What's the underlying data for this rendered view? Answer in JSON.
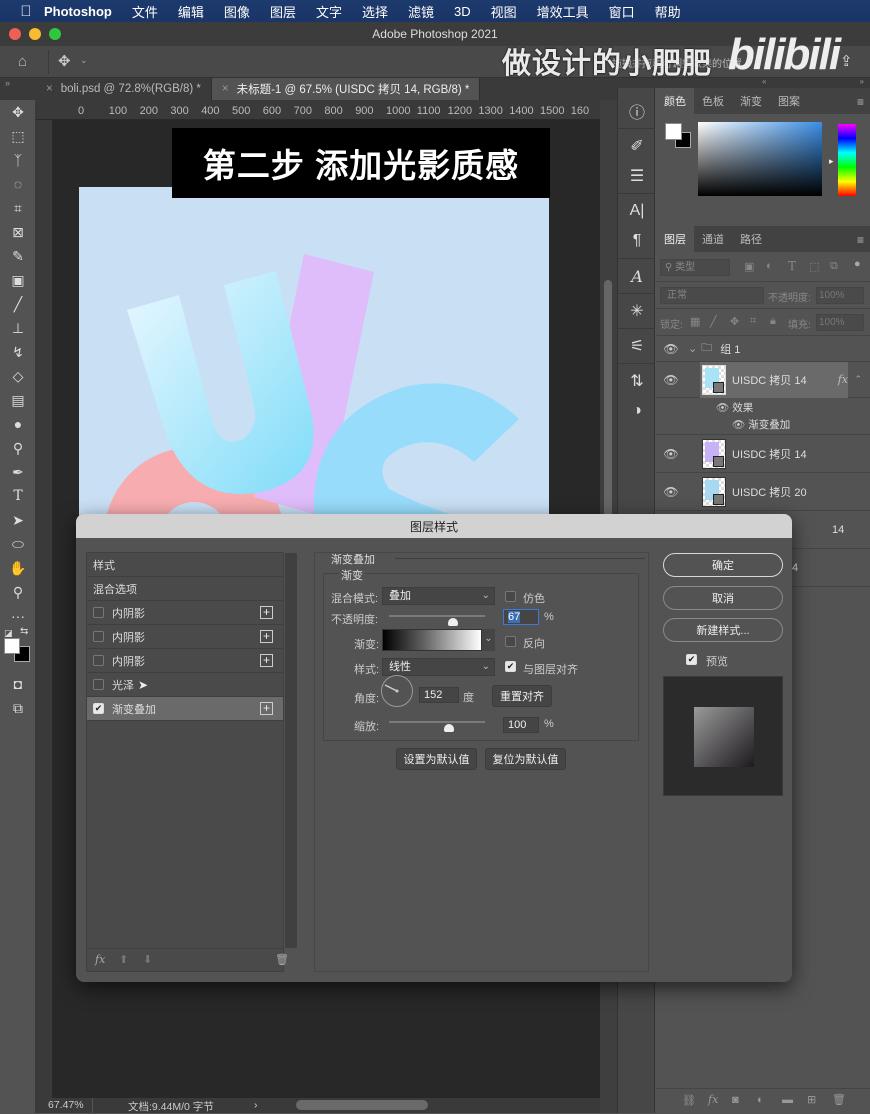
{
  "menubar": {
    "items": [
      "Photoshop",
      "文件",
      "编辑",
      "图像",
      "图层",
      "文字",
      "选择",
      "滤镜",
      "3D",
      "视图",
      "增效工具",
      "窗口",
      "帮助"
    ]
  },
  "window": {
    "title": "Adobe Photoshop 2021"
  },
  "overlay": {
    "watermark": "做设计的小肥肥",
    "brand": "bilibili",
    "search_hint": "拖拽并拖动可调整效果的位置"
  },
  "tabs": [
    {
      "label": "boli.psd @ 72.8%(RGB/8) *",
      "active": false
    },
    {
      "label": "未标题-1 @ 67.5% (UISDC 拷贝 14, RGB/8) *",
      "active": true
    }
  ],
  "ruler": {
    "h_ticks": [
      "0",
      "100",
      "200",
      "300",
      "400",
      "500",
      "600",
      "700",
      "800",
      "900",
      "1000",
      "1100",
      "1200",
      "1300",
      "1400",
      "1500",
      "160"
    ]
  },
  "canvas": {
    "banner_text": "第二步 添加光影质感"
  },
  "status": {
    "zoom": "67.47%",
    "doc": "文档:9.44M/0 字节",
    "arrow": "›"
  },
  "color_panel": {
    "tabs": [
      "颜色",
      "色板",
      "渐变",
      "图案"
    ],
    "active": "颜色"
  },
  "layers_panel": {
    "tabs": [
      "图层",
      "通道",
      "路径"
    ],
    "filter_label": "类型",
    "blend_mode": "正常",
    "opacity_label": "不透明度:",
    "opacity_value": "100%",
    "lock_label": "锁定:",
    "fill_label": "填充:",
    "fill_value": "100%",
    "group_name": "组 1",
    "layers": [
      {
        "name": "UISDC 拷贝 14",
        "fx": "fx",
        "selected": true,
        "thumb": "#a8e4f6"
      },
      {
        "name": "UISDC 拷贝 14",
        "thumb": "#c7b2f5"
      },
      {
        "name": "UISDC 拷贝 20",
        "thumb": "#a8d8f2"
      },
      {
        "name": "14",
        "thumb": "#f4a6a6"
      },
      {
        "name": "4",
        "thumb": "#aaa"
      }
    ],
    "effects_label": "效果",
    "effect_item": "渐变叠加"
  },
  "dialog": {
    "title": "图层样式",
    "styles_header": "样式",
    "blend_options": "混合选项",
    "styles": [
      {
        "label": "内阴影",
        "checked": false,
        "plus": true
      },
      {
        "label": "内阴影",
        "checked": false,
        "plus": true
      },
      {
        "label": "内阴影",
        "checked": false,
        "plus": true
      },
      {
        "label": "光泽",
        "checked": false,
        "plus": false
      },
      {
        "label": "渐变叠加",
        "checked": true,
        "plus": true,
        "selected": true
      }
    ],
    "section_title": "渐变叠加",
    "group_title": "渐变",
    "blend_mode_label": "混合模式:",
    "blend_mode_value": "叠加",
    "dither_label": "仿色",
    "dither_checked": false,
    "opacity_label": "不透明度:",
    "opacity_value": "67",
    "opacity_percent": 67,
    "percent": "%",
    "gradient_label": "渐变:",
    "reverse_label": "反向",
    "reverse_checked": false,
    "style_label": "样式:",
    "style_value": "线性",
    "align_label": "与图层对齐",
    "align_checked": true,
    "angle_label": "角度:",
    "angle_value": "152",
    "angle_unit": "度",
    "reset_align": "重置对齐",
    "scale_label": "缩放:",
    "scale_value": "100",
    "scale_percent": 100,
    "set_default": "设置为默认值",
    "reset_default": "复位为默认值",
    "ok": "确定",
    "cancel": "取消",
    "new_style": "新建样式...",
    "preview_label": "预览",
    "preview_checked": true
  }
}
